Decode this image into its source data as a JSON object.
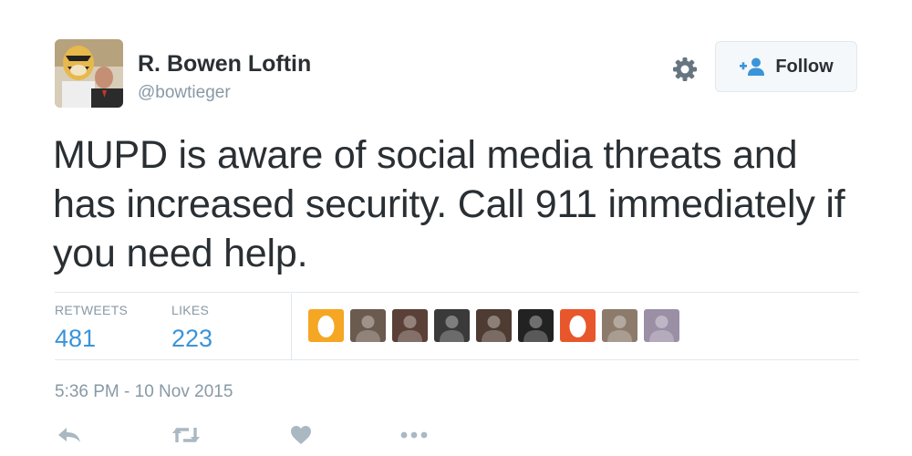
{
  "user": {
    "display_name": "R. Bowen Loftin",
    "handle": "@bowtieger"
  },
  "header": {
    "settings_icon": "gear-icon",
    "follow_label": "Follow",
    "follow_icon": "add-user-icon"
  },
  "tweet": {
    "text": "MUPD is aware of social media threats and has increased security. Call 911 immediately if you need help.",
    "timestamp": "5:36 PM - 10 Nov 2015"
  },
  "stats": {
    "retweets_label": "RETWEETS",
    "retweets_count": "481",
    "likes_label": "LIKES",
    "likes_count": "223"
  },
  "likers": [
    {
      "type": "egg",
      "color": "#f5a623"
    },
    {
      "type": "photo",
      "color": "#6b5a4e"
    },
    {
      "type": "photo",
      "color": "#5a4037"
    },
    {
      "type": "photo",
      "color": "#3a3a3a"
    },
    {
      "type": "photo",
      "color": "#4e3b31"
    },
    {
      "type": "photo",
      "color": "#222222"
    },
    {
      "type": "egg",
      "color": "#e8572b"
    },
    {
      "type": "photo",
      "color": "#8c7b6b"
    },
    {
      "type": "photo",
      "color": "#9b8fa6"
    }
  ],
  "actions": [
    "reply-icon",
    "retweet-icon",
    "like-icon",
    "more-icon"
  ],
  "colors": {
    "accent": "#3b94d9",
    "muted": "#8899a6",
    "text": "#292f33",
    "border": "#e1e8ed"
  }
}
